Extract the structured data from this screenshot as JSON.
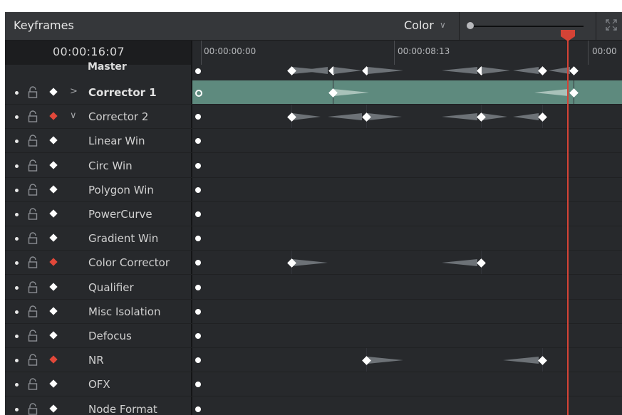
{
  "header": {
    "title": "Keyframes",
    "mode": "Color",
    "icons": {
      "mode_dropdown": "chevron-down-icon",
      "expand": "expand-icon",
      "zoom": "zoom-slider"
    }
  },
  "timeline": {
    "timecode": "00:00:16:07",
    "ruler_labels": [
      "00:00:00:00",
      "00:00:08:13",
      "00:00"
    ],
    "playhead_color": "#d44336"
  },
  "rows": [
    {
      "label": "Master",
      "bold": true
    },
    {
      "label": "Corrector 1",
      "bold": true,
      "expand": ">",
      "keyframe_color": "white"
    },
    {
      "label": "Corrector 2",
      "bold": false,
      "expand": "v",
      "keyframe_color": "red"
    },
    {
      "label": "Linear Win",
      "keyframe_color": "white"
    },
    {
      "label": "Circ Win",
      "keyframe_color": "white"
    },
    {
      "label": "Polygon Win",
      "keyframe_color": "white"
    },
    {
      "label": "PowerCurve",
      "keyframe_color": "white"
    },
    {
      "label": "Gradient Win",
      "keyframe_color": "white"
    },
    {
      "label": "Color Corrector",
      "keyframe_color": "red"
    },
    {
      "label": "Qualifier",
      "keyframe_color": "white"
    },
    {
      "label": "Misc Isolation",
      "keyframe_color": "white"
    },
    {
      "label": "Defocus",
      "keyframe_color": "white"
    },
    {
      "label": "NR",
      "keyframe_color": "red"
    },
    {
      "label": "OFX",
      "keyframe_color": "white"
    },
    {
      "label": "Node Format",
      "keyframe_color": "white"
    }
  ],
  "colors": {
    "accent_red": "#e2483a",
    "selected_row": "#5e8a7e",
    "panel_bg": "#27292c"
  }
}
